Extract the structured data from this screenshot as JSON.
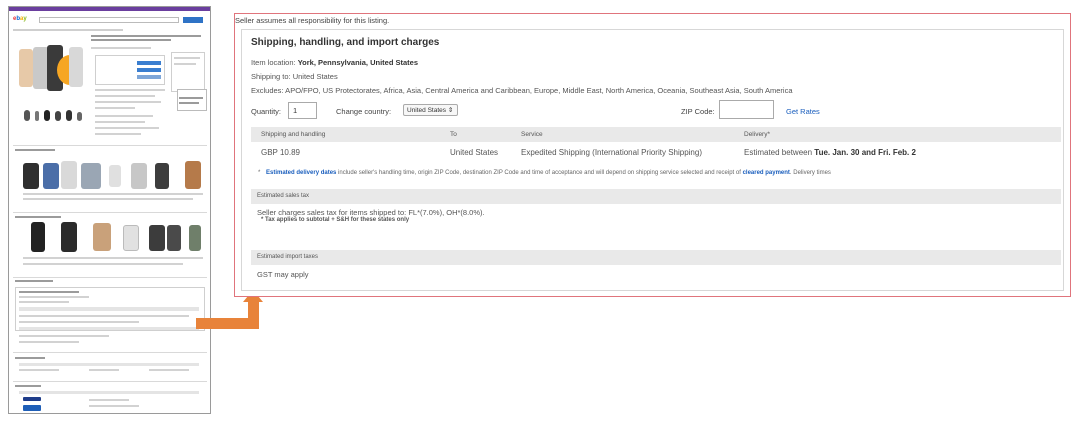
{
  "thumbnail": {
    "logo_letters": [
      "e",
      "b",
      "a",
      "y"
    ]
  },
  "detail": {
    "disclaimer": "Seller assumes all responsibility for this listing.",
    "section_title": "Shipping, handling, and import charges",
    "item_location_label": "Item location:",
    "item_location_value": "York, Pennsylvania, United States",
    "shipping_to": "Shipping to: United States",
    "excludes": "Excludes: APO/FPO, US Protectorates, Africa, Asia, Central America and Caribbean, Europe, Middle East, North America, Oceania, Southeast Asia, South America",
    "quantity_label": "Quantity:",
    "quantity_value": "1",
    "change_country_label": "Change country:",
    "country_selected": "United States ⇕",
    "zip_label": "ZIP Code:",
    "get_rates_label": "Get Rates",
    "table": {
      "headers": [
        "Shipping and handling",
        "To",
        "Service",
        "Delivery*"
      ],
      "row": {
        "cost": "GBP 10.89",
        "to": "United States",
        "service": "Expedited Shipping (International Priority Shipping)",
        "delivery_prefix": "Estimated between",
        "delivery_dates": "Tue. Jan. 30 and Fri. Feb. 2"
      }
    },
    "delivery_note_star": "*",
    "delivery_note_link": "Estimated delivery dates",
    "delivery_note_text": "include seller's handling time, origin ZIP Code, destination ZIP Code and time of acceptance and will depend on shipping service selected and receipt of",
    "delivery_note_link2": "cleared payment",
    "delivery_note_end": ". Delivery times",
    "sales_tax_header": "Estimated sales tax",
    "sales_tax_text": "Seller charges sales tax for items shipped to: FL*(7.0%), OH*(8.0%).",
    "sales_tax_sub": "* Tax applies to subtotal + S&H for these states only",
    "import_taxes_header": "Estimated import taxes",
    "import_taxes_text": "GST may apply"
  },
  "colors": {
    "highlight_border": "#e0747c",
    "arrow": "#e8833a",
    "link": "#1a5ebd",
    "header_bar": "#e9e9e9"
  }
}
